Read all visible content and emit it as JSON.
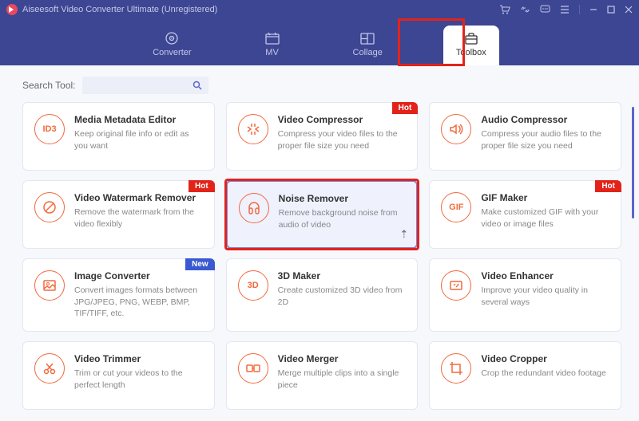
{
  "titlebar": {
    "title": "Aiseesoft Video Converter Ultimate (Unregistered)"
  },
  "nav": {
    "items": [
      {
        "label": "Converter"
      },
      {
        "label": "MV"
      },
      {
        "label": "Collage"
      },
      {
        "label": "Toolbox"
      }
    ]
  },
  "search": {
    "label": "Search Tool:"
  },
  "tools": [
    {
      "icon": "ID3",
      "title": "Media Metadata Editor",
      "desc": "Keep original file info or edit as you want",
      "badge": null
    },
    {
      "icon": "compress",
      "title": "Video Compressor",
      "desc": "Compress your video files to the proper file size you need",
      "badge": "Hot"
    },
    {
      "icon": "audio-compress",
      "title": "Audio Compressor",
      "desc": "Compress your audio files to the proper file size you need",
      "badge": null
    },
    {
      "icon": "watermark",
      "title": "Video Watermark Remover",
      "desc": "Remove the watermark from the video flexibly",
      "badge": "Hot"
    },
    {
      "icon": "noise",
      "title": "Noise Remover",
      "desc": "Remove background noise from audio of video",
      "badge": null,
      "selected": true
    },
    {
      "icon": "GIF",
      "title": "GIF Maker",
      "desc": "Make customized GIF with your video or image files",
      "badge": "Hot"
    },
    {
      "icon": "image-conv",
      "title": "Image Converter",
      "desc": "Convert images formats between JPG/JPEG, PNG, WEBP, BMP, TIF/TIFF, etc.",
      "badge": "New"
    },
    {
      "icon": "3D",
      "title": "3D Maker",
      "desc": "Create customized 3D video from 2D",
      "badge": null
    },
    {
      "icon": "enhance",
      "title": "Video Enhancer",
      "desc": "Improve your video quality in several ways",
      "badge": null
    },
    {
      "icon": "trim",
      "title": "Video Trimmer",
      "desc": "Trim or cut your videos to the perfect length",
      "badge": null
    },
    {
      "icon": "merge",
      "title": "Video Merger",
      "desc": "Merge multiple clips into a single piece",
      "badge": null
    },
    {
      "icon": "crop",
      "title": "Video Cropper",
      "desc": "Crop the redundant video footage",
      "badge": null
    }
  ],
  "badges": {
    "hot": "Hot",
    "new": "New"
  }
}
